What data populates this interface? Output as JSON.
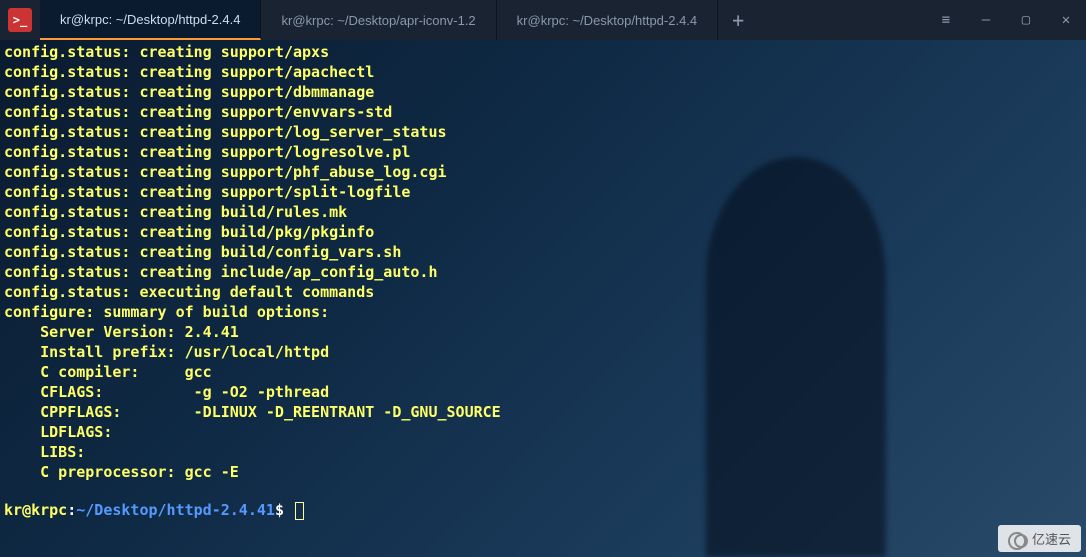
{
  "tabs": [
    {
      "label": "kr@krpc: ~/Desktop/httpd-2.4.4",
      "active": true
    },
    {
      "label": "kr@krpc: ~/Desktop/apr-iconv-1.2",
      "active": false
    },
    {
      "label": "kr@krpc: ~/Desktop/httpd-2.4.4",
      "active": false
    }
  ],
  "window": {
    "add": "+",
    "menu": "≡",
    "min": "—",
    "max": "▢",
    "close": "✕"
  },
  "terminal": {
    "lines": [
      "config.status: creating support/apxs",
      "config.status: creating support/apachectl",
      "config.status: creating support/dbmmanage",
      "config.status: creating support/envvars-std",
      "config.status: creating support/log_server_status",
      "config.status: creating support/logresolve.pl",
      "config.status: creating support/phf_abuse_log.cgi",
      "config.status: creating support/split-logfile",
      "config.status: creating build/rules.mk",
      "config.status: creating build/pkg/pkginfo",
      "config.status: creating build/config_vars.sh",
      "config.status: creating include/ap_config_auto.h",
      "config.status: executing default commands",
      "configure: summary of build options:",
      "",
      "    Server Version: 2.4.41",
      "    Install prefix: /usr/local/httpd",
      "    C compiler:     gcc",
      "    CFLAGS:          -g -O2 -pthread",
      "    CPPFLAGS:        -DLINUX -D_REENTRANT -D_GNU_SOURCE",
      "    LDFLAGS:",
      "    LIBS:",
      "    C preprocessor: gcc -E"
    ]
  },
  "prompt": {
    "user": "kr",
    "at": "@",
    "host": "krpc",
    "colon": ":",
    "path": "~/Desktop/httpd-2.4.41",
    "dollar": "$ "
  },
  "watermark": "亿速云"
}
